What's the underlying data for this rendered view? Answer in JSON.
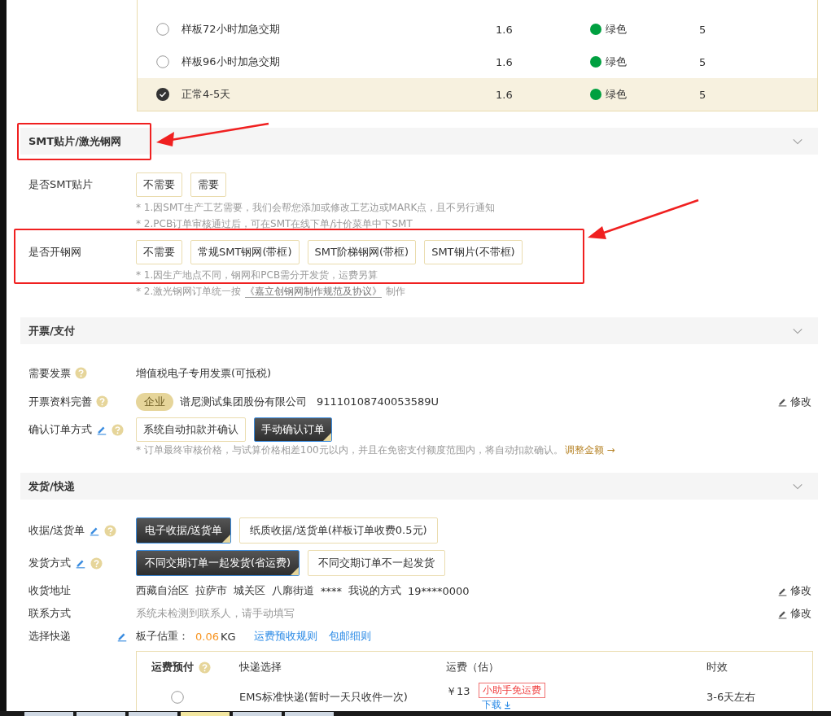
{
  "delivery_table": {
    "rows": [
      {
        "name": "样板72小时加急交期",
        "value": "1.6",
        "color_label": "绿色",
        "color": "#00a040",
        "count": "5",
        "selected": false
      },
      {
        "name": "样板96小时加急交期",
        "value": "1.6",
        "color_label": "绿色",
        "color": "#00a040",
        "count": "5",
        "selected": false
      },
      {
        "name": "正常4-5天",
        "value": "1.6",
        "color_label": "绿色",
        "color": "#00a040",
        "count": "5",
        "selected": true
      }
    ]
  },
  "smt_section": {
    "title": "SMT贴片/激光钢网",
    "rows": [
      {
        "label": "是否SMT贴片",
        "options": [
          {
            "label": "不需要",
            "selected": false
          },
          {
            "label": "需要",
            "selected": false
          }
        ],
        "notes": [
          {
            "text": "* 1.因SMT生产工艺需要，我们会帮您添加或修改工艺边或MARK点，且不另行通知"
          },
          {
            "text": "* 2.PCB订单审核通过后，可在SMT在线下单/计价菜单中下SMT"
          }
        ]
      },
      {
        "label": "是否开钢网",
        "options": [
          {
            "label": "不需要",
            "selected": false
          },
          {
            "label": "常规SMT钢网(带框)",
            "selected": false
          },
          {
            "label": "SMT阶梯钢网(带框)",
            "selected": false
          },
          {
            "label": "SMT钢片(不带框)",
            "selected": false
          }
        ],
        "notes": [
          {
            "text": "* 1.因生产地点不同，钢网和PCB需分开发货，运费另算"
          },
          {
            "text": "* 2.激光钢网订单统一按",
            "link": "《嘉立创钢网制作规范及协议》",
            "after": "制作"
          }
        ]
      }
    ]
  },
  "invoice_section": {
    "title": "开票/支付",
    "need_invoice": {
      "label": "需要发票",
      "value": "增值税电子专用发票(可抵税)"
    },
    "invoice_info": {
      "label": "开票资料完善",
      "tag": "企业",
      "company": "谱尼测试集团股份有限公司",
      "tax_id": "91110108740053589U",
      "edit": "修改"
    },
    "confirm": {
      "label": "确认订单方式",
      "options": [
        {
          "label": "系统自动扣款并确认",
          "selected": false
        },
        {
          "label": "手动确认订单",
          "selected": true
        }
      ],
      "note": "* 订单最终审核价格，与试算价格相差100元以内，并且在免密支付额度范围内，将自动扣款确认。",
      "link": "调整金额 →"
    }
  },
  "shipping_section": {
    "title": "发货/快递",
    "receipt": {
      "label": "收据/送货单",
      "options": [
        {
          "label": "电子收据/送货单",
          "selected": true
        },
        {
          "label": "纸质收据/送货单(样板订单收费0.5元)",
          "selected": false
        }
      ]
    },
    "method": {
      "label": "发货方式",
      "options": [
        {
          "label": "不同交期订单一起发货(省运费)",
          "selected": true
        },
        {
          "label": "不同交期订单不一起发货",
          "selected": false
        }
      ]
    },
    "address": {
      "label": "收货地址",
      "parts": [
        "西藏自治区",
        "拉萨市",
        "城关区",
        "八廓街道",
        "****",
        "我说的方式",
        "19****0000"
      ],
      "edit": "修改"
    },
    "contact": {
      "label": "联系方式",
      "value": "系统未检测到联系人，请手动填写",
      "edit": "修改"
    },
    "courier": {
      "label": "选择快递",
      "weight_label": "板子估重：",
      "weight": "0.06",
      "unit": "KG",
      "links": [
        "运费预收规则",
        "包邮细则"
      ],
      "columns": [
        "运费预付",
        "快递选择",
        "运费（估）",
        "时效"
      ],
      "rows": [
        {
          "name": "EMS标准快递(暂时一天只收件一次)",
          "price": "￥13",
          "badge": "小助手免运费",
          "download": "下载",
          "time": "3-6天左右",
          "selected": false
        }
      ]
    }
  }
}
